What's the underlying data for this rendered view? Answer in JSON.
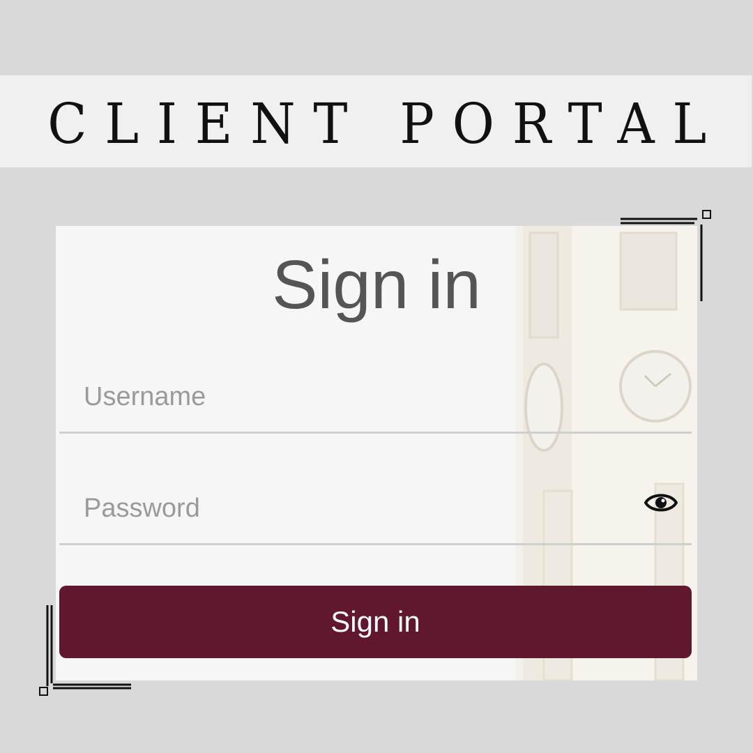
{
  "banner": {
    "title": "CLIENT PORTAL"
  },
  "signin": {
    "title": "Sign in",
    "username_placeholder": "Username",
    "username_value": "",
    "password_placeholder": "Password",
    "password_value": "",
    "submit_label": "Sign in",
    "show_password_icon": "eye-icon"
  },
  "colors": {
    "background": "#d9d9d9",
    "banner_bg": "#f0f0f0",
    "card_bg": "#f6f6f6",
    "button_bg": "#61172e",
    "button_text": "#ffffff",
    "title_text": "#555555",
    "placeholder_text": "#9a9a9a"
  }
}
